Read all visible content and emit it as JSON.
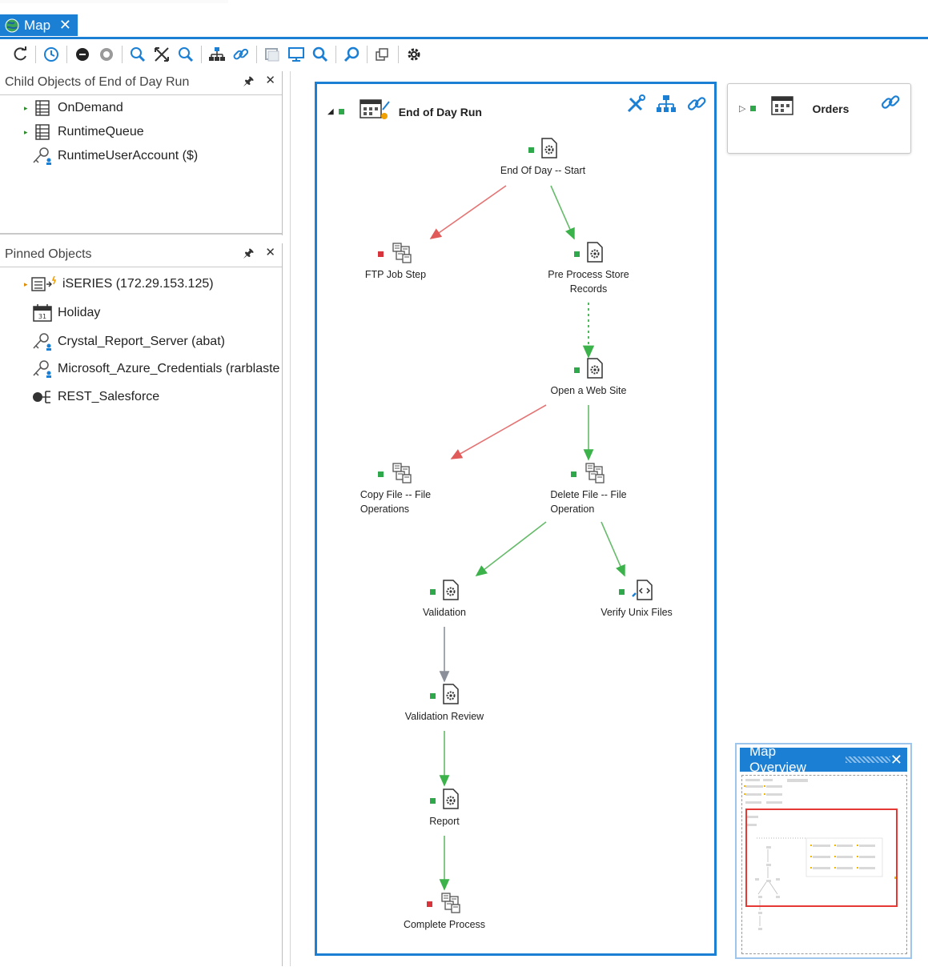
{
  "tab": {
    "title": "Map",
    "close": "✕"
  },
  "toolbar": {
    "buttons": [
      "refresh-icon",
      "history-icon",
      "stop-icon",
      "disable-icon",
      "zoom-in-icon",
      "fit-icon",
      "zoom-out-icon",
      "hierarchy-icon",
      "link-icon",
      "window-icon",
      "monitor-icon",
      "search-icon",
      "find-icon",
      "layers-icon",
      "settings-icon"
    ]
  },
  "child_panel": {
    "title": "Child Objects of End of Day Run",
    "pin": "🖈",
    "close": "✕",
    "items": [
      {
        "label": "OnDemand",
        "icon": "queue-icon"
      },
      {
        "label": "RuntimeQueue",
        "icon": "queue-icon"
      },
      {
        "label": "RuntimeUserAccount ($)",
        "icon": "user-account-icon"
      }
    ]
  },
  "pinned_panel": {
    "title": "Pinned Objects",
    "pin": "🖈",
    "close": "✕",
    "items": [
      {
        "label": "iSERIES (172.29.153.125)",
        "icon": "server-icon"
      },
      {
        "label": "Holiday",
        "icon": "calendar-icon"
      },
      {
        "label": "Crystal_Report_Server (abat)",
        "icon": "user-account-icon"
      },
      {
        "label": "Microsoft_Azure_Credentials (rarblaste",
        "icon": "user-account-icon"
      },
      {
        "label": "REST_Salesforce",
        "icon": "connection-icon"
      }
    ]
  },
  "map": {
    "eod_title": "End of Day Run",
    "orders_title": "Orders",
    "nodes": [
      {
        "label": "End Of Day -- Start",
        "status": "green",
        "type": "task"
      },
      {
        "label": "FTP Job Step",
        "status": "red",
        "type": "job"
      },
      {
        "label": "Pre Process Store\nRecords",
        "status": "green",
        "type": "task"
      },
      {
        "label": "Open a Web Site",
        "status": "green",
        "type": "task"
      },
      {
        "label": "Copy File -- File\nOperations",
        "status": "green",
        "type": "job"
      },
      {
        "label": "Delete File -- File\nOperation",
        "status": "green",
        "type": "job"
      },
      {
        "label": "Validation",
        "status": "green",
        "type": "task"
      },
      {
        "label": "Verify Unix Files",
        "status": "green",
        "type": "script"
      },
      {
        "label": "Validation Review",
        "status": "green",
        "type": "task"
      },
      {
        "label": "Report",
        "status": "green",
        "type": "task"
      },
      {
        "label": "Complete Process",
        "status": "red",
        "type": "job"
      }
    ]
  },
  "overview": {
    "title": "Map Overview",
    "close": "✕"
  },
  "colors": {
    "accent": "#1b7fd4",
    "success": "#2ea84a",
    "failure": "#d8343c",
    "viewport": "#e53935"
  }
}
